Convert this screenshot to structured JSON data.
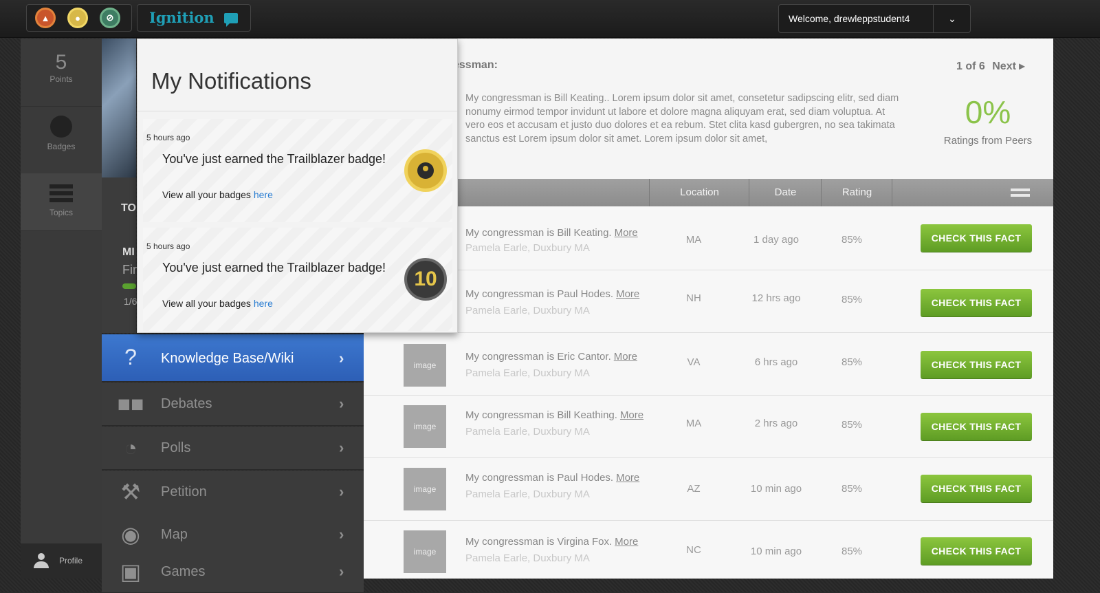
{
  "topbar": {
    "brand": "Ignition",
    "welcome": "Welcome, drewleppstudent4",
    "icons": [
      "hat-icon",
      "badge-icon",
      "compass-icon"
    ]
  },
  "rail": {
    "points_value": "5",
    "points_label": "Points",
    "badges_label": "Badges",
    "topics_label": "Topics",
    "profile_label": "Profile"
  },
  "behind": {
    "to": "TO",
    "mi": "MI",
    "fi": "Fir",
    "fr": "1/6"
  },
  "nav": [
    {
      "label": "Knowledge Base/Wiki",
      "icon": "?"
    },
    {
      "label": "Debates",
      "icon": "people-icon"
    },
    {
      "label": "Polls",
      "icon": "pie-icon"
    },
    {
      "label": "Petition",
      "icon": "gavel-icon"
    },
    {
      "label": "Map",
      "icon": "globe-icon"
    },
    {
      "label": "Games",
      "icon": "monitor-icon"
    }
  ],
  "main": {
    "heading": "essman:",
    "pager": "1 of 6",
    "next": "Next",
    "description": "My congressman is Bill Keating.. Lorem ipsum dolor sit amet, consetetur sadipscing elitr, sed diam nonumy eirmod tempor invidunt ut labore et dolore magna aliquyam erat, sed diam voluptua. At vero eos et accusam et justo duo dolores et ea rebum. Stet clita kasd gubergren, no sea takimata sanctus est Lorem ipsum dolor sit amet. Lorem ipsum dolor sit amet,",
    "percent": "0%",
    "percent_label": "Ratings from Peers",
    "columns": [
      "Location",
      "Date",
      "Rating"
    ],
    "rows": [
      {
        "title": "My congressman is Bill Keating.",
        "more": "More",
        "sub": "Pamela Earle, Duxbury MA",
        "loc": "MA",
        "date": "1 day ago",
        "rating": "85%",
        "cta": "CHECK THIS FACT",
        "thumb": ""
      },
      {
        "title": "My congressman is Paul Hodes.",
        "more": "More",
        "sub": "Pamela Earle, Duxbury MA",
        "loc": "NH",
        "date": "12 hrs ago",
        "rating": "85%",
        "cta": "CHECK THIS FACT",
        "thumb": ""
      },
      {
        "title": "My congressman is Eric Cantor.",
        "more": "More",
        "sub": "Pamela Earle, Duxbury MA",
        "loc": "VA",
        "date": "6 hrs ago",
        "rating": "85%",
        "cta": "CHECK THIS FACT",
        "thumb": "image"
      },
      {
        "title": "My congressman is Bill Keathing.",
        "more": "More",
        "sub": "Pamela Earle, Duxbury MA",
        "loc": "MA",
        "date": "2 hrs ago",
        "rating": "85%",
        "cta": "CHECK THIS FACT",
        "thumb": "image"
      },
      {
        "title": "My congressman is Paul Hodes.",
        "more": "More",
        "sub": "Pamela Earle, Duxbury MA",
        "loc": "AZ",
        "date": "10 min ago",
        "rating": "85%",
        "cta": "CHECK THIS FACT",
        "thumb": "image"
      },
      {
        "title": "My congressman is Virgina Fox.",
        "more": "More",
        "sub": "Pamela Earle, Duxbury MA",
        "loc": "NC",
        "date": "10 min ago",
        "rating": "85%",
        "cta": "CHECK THIS FACT",
        "thumb": "image"
      }
    ]
  },
  "notifications": {
    "title": "My Notifications",
    "items": [
      {
        "time": "5 hours ago",
        "message": "You've just earned the Trailblazer badge!",
        "link_prefix": "View all your badges",
        "link": "here",
        "medal": ""
      },
      {
        "time": "5 hours ago",
        "message": "You've just earned the Trailblazer badge!",
        "link_prefix": "View all your badges",
        "link": "here",
        "medal": "10"
      }
    ]
  },
  "colors": {
    "accent_green": "#8bc34a",
    "nav_active": "#3d78cf",
    "brand": "#1f9fb6"
  }
}
